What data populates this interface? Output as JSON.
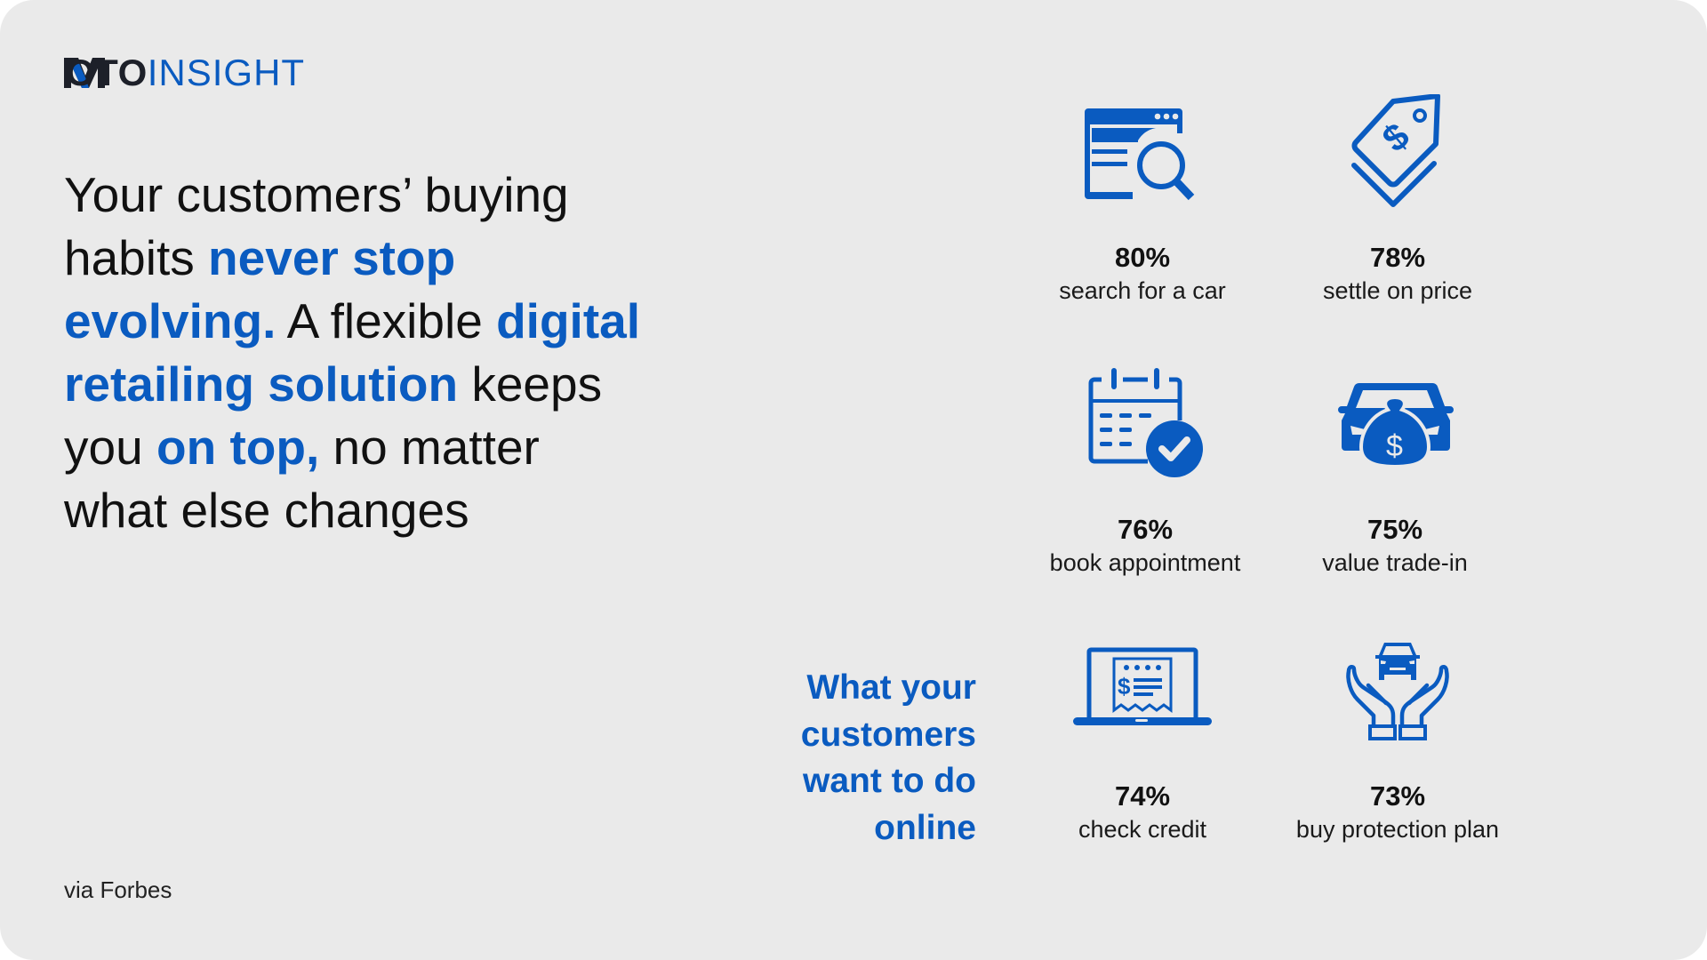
{
  "brand": {
    "logo_part1": "MOTO",
    "logo_part2": "INSIGHT",
    "accent_color": "#0a5bc0",
    "dark_color": "#1d2029",
    "background_color": "#eaeaea"
  },
  "headline": {
    "segments": [
      {
        "text": "Your customers’ buying habits ",
        "highlight": false
      },
      {
        "text": "never stop evolving.",
        "highlight": true
      },
      {
        "text": " A flexible ",
        "highlight": false
      },
      {
        "text": "digital retailing solution",
        "highlight": true
      },
      {
        "text": " keeps you ",
        "highlight": false
      },
      {
        "text": "on top,",
        "highlight": true
      },
      {
        "text": " no matter what else changes",
        "highlight": false
      }
    ],
    "lines": [
      [
        {
          "t": "Your customers’ buying",
          "h": false
        }
      ],
      [
        {
          "t": "habits ",
          "h": false
        },
        {
          "t": "never stop",
          "h": true
        }
      ],
      [
        {
          "t": "evolving.",
          "h": true
        },
        {
          "t": " A flexible ",
          "h": false
        },
        {
          "t": "digital",
          "h": true
        }
      ],
      [
        {
          "t": "retailing solution",
          "h": true
        },
        {
          "t": " keeps",
          "h": false
        }
      ],
      [
        {
          "t": "you ",
          "h": false
        },
        {
          "t": "on top,",
          "h": true
        },
        {
          "t": " no matter",
          "h": false
        }
      ],
      [
        {
          "t": "what else changes",
          "h": false
        }
      ]
    ]
  },
  "side_title": {
    "lines": [
      "What your",
      "customers",
      "want to do",
      "online"
    ]
  },
  "source": "via Forbes",
  "stats": [
    {
      "percent": "80%",
      "label": "search for a car",
      "icon": "browser-search-icon"
    },
    {
      "percent": "78%",
      "label": "settle on price",
      "icon": "price-tag-icon"
    },
    {
      "percent": "76%",
      "label": "book appointment",
      "icon": "calendar-check-icon"
    },
    {
      "percent": "75%",
      "label": "value trade-in",
      "icon": "car-money-bag-icon"
    },
    {
      "percent": "74%",
      "label": "check credit",
      "icon": "laptop-receipt-icon"
    },
    {
      "percent": "73%",
      "label": "buy protection plan",
      "icon": "hands-car-icon"
    }
  ]
}
